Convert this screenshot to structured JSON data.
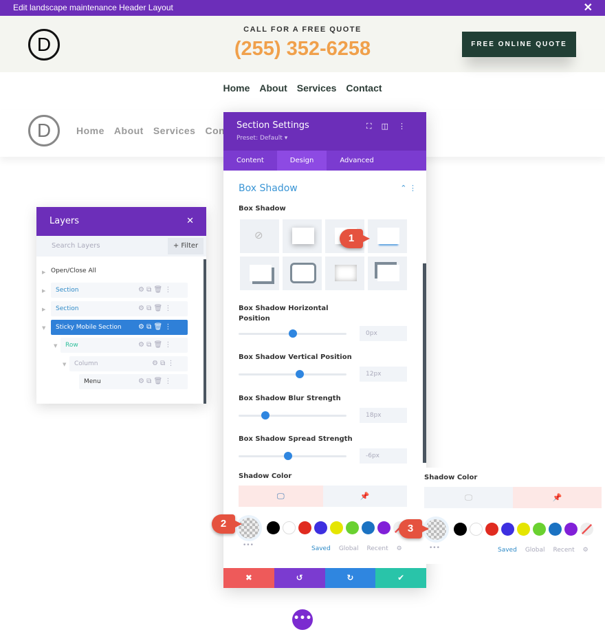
{
  "window": {
    "title": "Edit landscape maintenance Header Layout",
    "close": "✕"
  },
  "header": {
    "logo": "D",
    "cta": "CALL FOR A FREE QUOTE",
    "phone": "(255) 352-6258",
    "button": "FREE ONLINE QUOTE",
    "menu": [
      "Home",
      "About",
      "Services",
      "Contact"
    ]
  },
  "sticky_header": {
    "logo": "D",
    "menu": [
      "Home",
      "About",
      "Services",
      "Contact"
    ]
  },
  "layers": {
    "title": "Layers",
    "close": "✕",
    "search_placeholder": "Search Layers",
    "filter": "+ Filter",
    "open_close": "Open/Close All",
    "items": [
      {
        "label": "Section",
        "color": "#2e8ac7"
      },
      {
        "label": "Section",
        "color": "#2e8ac7"
      },
      {
        "label": "Sticky Mobile Section",
        "selected": true
      },
      {
        "label": "Row",
        "color": "#2fbf9b"
      },
      {
        "label": "Column",
        "color": "#aab"
      },
      {
        "label": "Menu",
        "color": "#333"
      }
    ]
  },
  "settings": {
    "title": "Section Settings",
    "preset": "Preset: Default ▾",
    "tabs": [
      "Content",
      "Design",
      "Advanced"
    ],
    "active_tab": "Design",
    "section_title": "Box Shadow",
    "box_shadow_label": "Box Shadow",
    "selected_preset": 4,
    "sliders": [
      {
        "label": "Box Shadow Horizontal Position",
        "value": "0px",
        "fraction": 0.5
      },
      {
        "label": "Box Shadow Vertical Position",
        "value": "12px",
        "fraction": 0.57
      },
      {
        "label": "Box Shadow Blur Strength",
        "value": "18px",
        "fraction": 0.25
      },
      {
        "label": "Box Shadow Spread Strength",
        "value": "-6px",
        "fraction": 0.46
      }
    ],
    "shadow_color_label": "Shadow Color",
    "color_tabs": [
      "Saved",
      "Global",
      "Recent"
    ],
    "swatches": [
      "#000000",
      "#ffffff",
      "#e02b20",
      "#3d2fe0",
      "#e5e500",
      "#6ad130",
      "#1b72c2",
      "#8120d8"
    ],
    "actions": {
      "cancel": "✖",
      "undo": "↺",
      "redo": "↻",
      "save": "✔"
    }
  },
  "shadow_color_sticky": {
    "label": "Shadow Color"
  },
  "badges": [
    "1",
    "2",
    "3"
  ],
  "more_button": "•••"
}
